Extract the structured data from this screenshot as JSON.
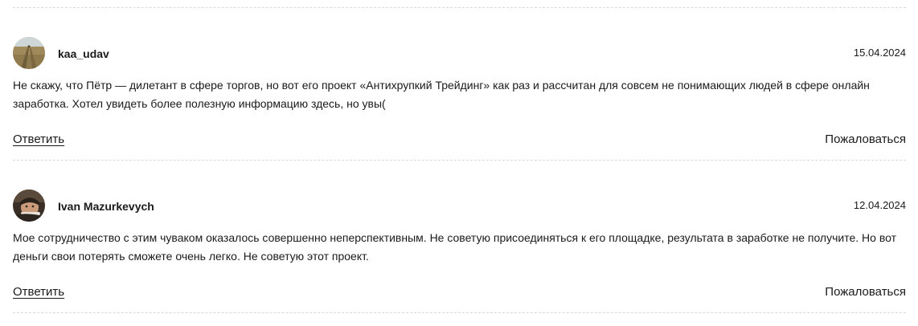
{
  "comments": [
    {
      "author": "kaa_udav",
      "date": "15.04.2024",
      "text": "Не скажу, что Пётр — дилетант в сфере торгов, но вот его проект «Антихрупкий Трейдинг» как раз и рассчитан для совсем не понимающих людей в сфере онлайн заработка. Хотел увидеть более полезную информацию здесь, но увы(",
      "reply_label": "Ответить",
      "report_label": "Пожаловаться",
      "avatar_icon": "avatar-landscape-photo"
    },
    {
      "author": "Ivan Mazurkevych",
      "date": "12.04.2024",
      "text": "Мое сотрудничество с этим чуваком оказалось совершенно неперспективным. Не советую присоединяться к его площадке, результата в заработке не получите. Но вот деньги свои потерять сможете очень легко. Не советую этот проект.",
      "reply_label": "Ответить",
      "report_label": "Пожаловаться",
      "avatar_icon": "avatar-person-photo"
    }
  ],
  "colors": {
    "text": "#1a1a1a",
    "divider": "#d9d9d9",
    "background": "#ffffff"
  }
}
